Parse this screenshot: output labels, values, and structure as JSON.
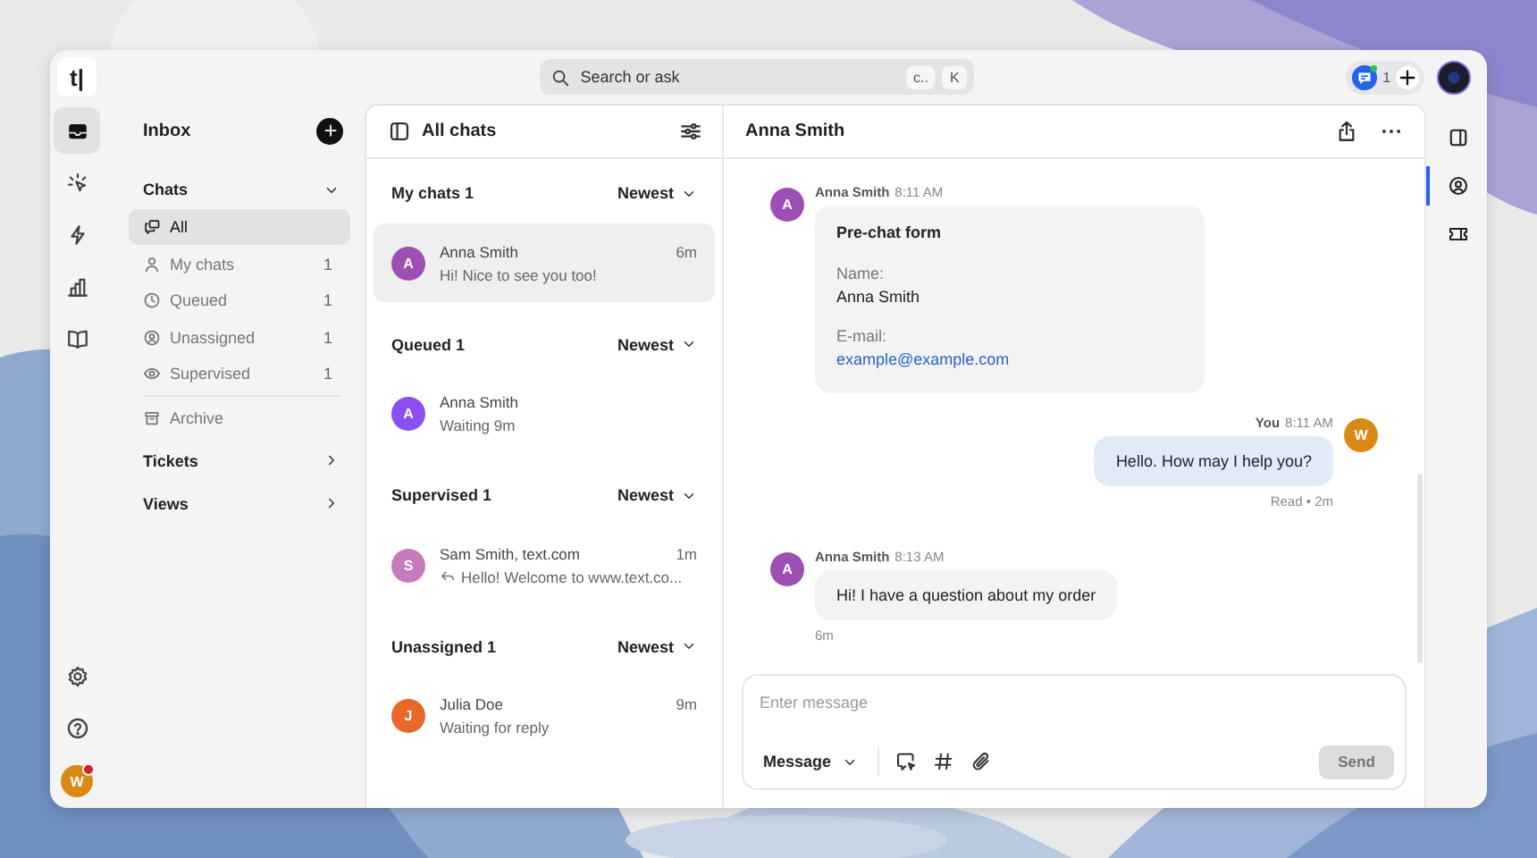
{
  "app": {
    "logo": "t|"
  },
  "search": {
    "placeholder": "Search or ask",
    "keys": [
      "c..",
      "K"
    ]
  },
  "top_right": {
    "count": "1"
  },
  "rail": [
    {
      "kind": "inbox",
      "selected": true
    },
    {
      "kind": "sparkle",
      "selected": false
    },
    {
      "kind": "bolt",
      "selected": false
    },
    {
      "kind": "chart",
      "selected": false
    },
    {
      "kind": "book",
      "selected": false
    }
  ],
  "user": {
    "initial": "W",
    "notification": true
  },
  "sidebar": {
    "title": "Inbox",
    "sections": [
      {
        "label": "Chats",
        "expanded": true,
        "items": [
          {
            "kind": "all",
            "label": "All",
            "selected": true
          },
          {
            "kind": "person",
            "label": "My chats",
            "count": "1",
            "selected": false
          },
          {
            "kind": "clock",
            "label": "Queued",
            "count": "1",
            "selected": false
          },
          {
            "kind": "user-circle",
            "label": "Unassigned",
            "count": "1",
            "selected": false
          },
          {
            "kind": "eye",
            "label": "Supervised",
            "count": "1",
            "selected": false
          },
          {
            "kind": "archive",
            "label": "Archive",
            "selected": false
          }
        ]
      },
      {
        "label": "Tickets",
        "expanded": false
      },
      {
        "label": "Views",
        "expanded": false
      }
    ]
  },
  "chat_list": {
    "title": "All chats",
    "groups": [
      {
        "title": "My chats 1",
        "sort": "Newest",
        "chats": [
          {
            "initial": "A",
            "color": "#9d4fb3",
            "name": "Anna Smith",
            "time": "6m",
            "preview": "Hi! Nice to see you too!",
            "replied": false,
            "selected": true
          }
        ]
      },
      {
        "title": "Queued 1",
        "sort": "Newest",
        "chats": [
          {
            "initial": "A",
            "color": "#8b4ff0",
            "name": "Anna Smith",
            "preview": "Waiting 9m",
            "replied": false,
            "selected": false
          }
        ]
      },
      {
        "title": "Supervised 1",
        "sort": "Newest",
        "chats": [
          {
            "initial": "S",
            "color": "#c77ab9",
            "name": "Sam Smith, text.com",
            "time": "1m",
            "preview": "Hello! Welcome to www.text.co...",
            "replied": true,
            "selected": false
          }
        ]
      },
      {
        "title": "Unassigned 1",
        "sort": "Newest",
        "chats": [
          {
            "initial": "J",
            "color": "#e8682a",
            "name": "Julia Doe",
            "time": "9m",
            "preview": "Waiting for reply",
            "replied": false,
            "selected": false
          }
        ]
      }
    ]
  },
  "conversation": {
    "title": "Anna Smith",
    "messages": [
      {
        "kind": "form",
        "author": "Anna Smith",
        "time": "8:11 AM",
        "initial": "A",
        "title": "Pre-chat form",
        "fields": [
          {
            "label": "Name:",
            "value": "Anna Smith",
            "link": false
          },
          {
            "label": "E-mail:",
            "value": "example@example.com",
            "link": true
          }
        ]
      },
      {
        "kind": "outgoing",
        "author": "You",
        "time": "8:11 AM",
        "initial": "W",
        "text": "Hello. How may I help you?",
        "status": "Read • 2m"
      },
      {
        "kind": "incoming",
        "author": "Anna Smith",
        "time": "8:13 AM",
        "initial": "A",
        "text": "Hi! I have a question about my order",
        "footer": "6m"
      }
    ]
  },
  "composer": {
    "placeholder": "Enter message",
    "mode": "Message",
    "send": "Send",
    "send_disabled": true
  },
  "right_rail": [
    {
      "kind": "panel",
      "selected": false
    },
    {
      "kind": "person",
      "selected": true
    },
    {
      "kind": "ticket",
      "selected": false
    }
  ]
}
